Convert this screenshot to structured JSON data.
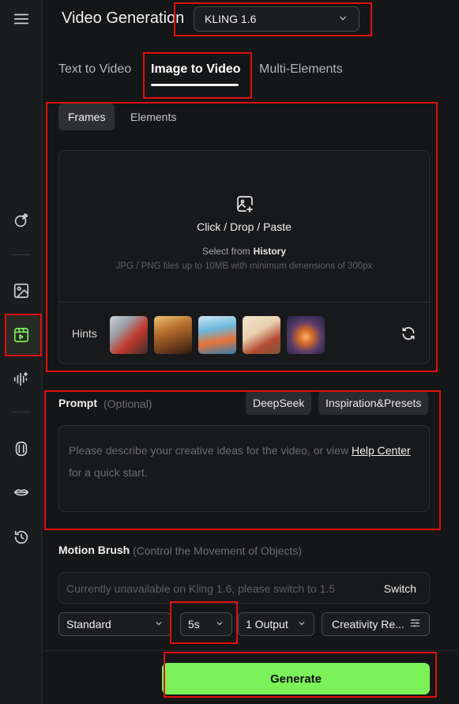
{
  "header": {
    "title": "Video Generation",
    "model": "KLING 1.6"
  },
  "tabs": [
    {
      "label": "Text to Video",
      "active": false
    },
    {
      "label": "Image to Video",
      "active": true
    },
    {
      "label": "Multi-Elements",
      "active": false
    }
  ],
  "subtabs": [
    {
      "label": "Frames",
      "active": true
    },
    {
      "label": "Elements",
      "active": false
    }
  ],
  "upload": {
    "main_text": "Click / Drop / Paste",
    "select_prefix": "Select from",
    "select_link": "History",
    "hint": "JPG / PNG files up to 10MB with minimum dimensions of 300px"
  },
  "hints": {
    "label": "Hints"
  },
  "prompt": {
    "label": "Prompt",
    "optional": "(Optional)",
    "deepseek": "DeepSeek",
    "inspiration": "Inspiration&Presets",
    "placeholder_before": "Please describe your creative ideas for the video, or view",
    "help_link": "Help Center",
    "placeholder_after": "for a quick start."
  },
  "motion_brush": {
    "label": "Motion Brush",
    "sub": "(Control the Movement of Objects)",
    "unavailable": "Currently unavailable on Kling 1.6, please switch to 1.5",
    "switch": "Switch"
  },
  "controls": {
    "mode": "Standard",
    "duration": "5s",
    "outputs": "1 Output",
    "creativity": "Creativity Re..."
  },
  "generate": "Generate",
  "colors": {
    "accent": "#7cf25a",
    "highlight": "#e01010"
  }
}
